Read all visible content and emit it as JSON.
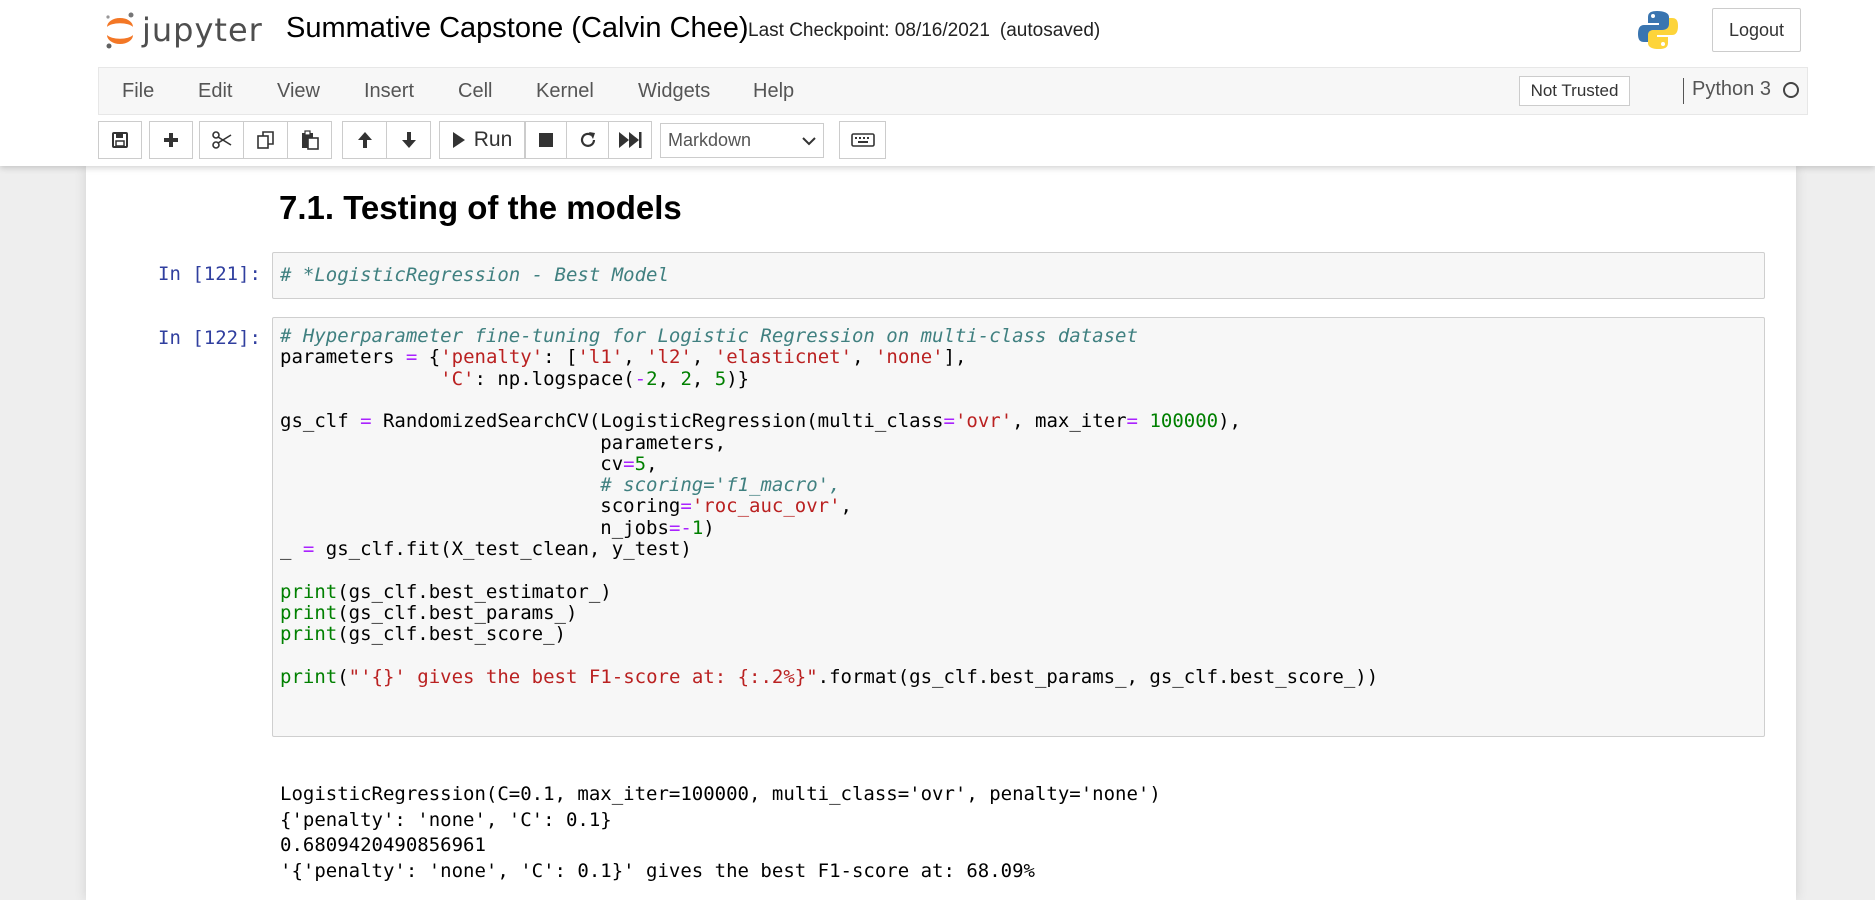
{
  "header": {
    "logo_text": "jupyter",
    "notebook_name": "Summative Capstone (Calvin Chee)",
    "checkpoint": "Last Checkpoint: 08/16/2021",
    "autosave_status": "(autosaved)",
    "logout_label": "Logout"
  },
  "menubar": {
    "items": [
      "File",
      "Edit",
      "View",
      "Insert",
      "Cell",
      "Kernel",
      "Widgets",
      "Help"
    ],
    "trust_label": "Not Trusted",
    "kernel_name": "Python 3"
  },
  "toolbar": {
    "run_label": "Run",
    "cell_type": "Markdown",
    "icons": [
      "save-icon",
      "plus-icon",
      "cut-icon",
      "copy-icon",
      "paste-icon",
      "arrow-up-icon",
      "arrow-down-icon",
      "play-icon",
      "stop-icon",
      "restart-icon",
      "fast-forward-icon",
      "keyboard-icon"
    ]
  },
  "notebook": {
    "heading": "7.1. Testing of the models",
    "cell1": {
      "prompt": "In [121]:",
      "code": "# *LogisticRegression - Best Model"
    },
    "cell2": {
      "prompt": "In [122]:",
      "lines": [
        "# Hyperparameter fine-tuning for Logistic Regression on multi-class dataset",
        "parameters = {'penalty': ['l1', 'l2', 'elasticnet', 'none'],",
        "              'C': np.logspace(-2, 2, 5)}",
        "",
        "gs_clf = RandomizedSearchCV(LogisticRegression(multi_class='ovr', max_iter= 100000),",
        "                            parameters,",
        "                            cv=5,",
        "                            # scoring='f1_macro',",
        "                            scoring='roc_auc_ovr',",
        "                            n_jobs=-1)",
        "_ = gs_clf.fit(X_test_clean, y_test)",
        "",
        "print(gs_clf.best_estimator_)",
        "print(gs_clf.best_params_)",
        "print(gs_clf.best_score_)",
        "",
        "print(\"'{}' gives the best F1-score at: {:.2%}\".format(gs_clf.best_params_, gs_clf.best_score_))"
      ],
      "output": [
        "LogisticRegression(C=0.1, max_iter=100000, multi_class='ovr', penalty='none')",
        "{'penalty': 'none', 'C': 0.1}",
        "0.6809420490856961",
        "'{'penalty': 'none', 'C': 0.1}' gives the best F1-score at: 68.09%"
      ]
    }
  }
}
